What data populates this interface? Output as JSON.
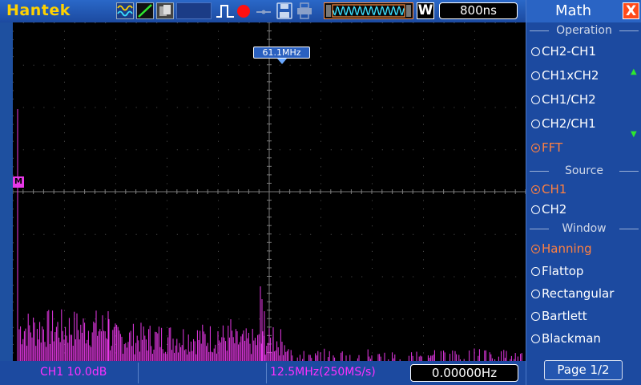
{
  "app": {
    "brand": "Hantek"
  },
  "toolbar": {
    "timebase_mark": "W",
    "timebase": "800ns"
  },
  "screen": {
    "freq_marker": "61.1MHz",
    "math_marker": "M"
  },
  "status": {
    "ch1_scale": "CH1 10.0dB",
    "sample_rate": "12.5MHz(250MS/s)",
    "freq_readout": "0.00000Hz"
  },
  "menu": {
    "title": "Math",
    "close": "X",
    "operation": {
      "label": "Operation",
      "options": [
        "CH2-CH1",
        "CH1xCH2",
        "CH1/CH2",
        "CH2/CH1",
        "FFT"
      ],
      "selected": "FFT"
    },
    "source": {
      "label": "Source",
      "options": [
        "CH1",
        "CH2"
      ],
      "selected": "CH1"
    },
    "window": {
      "label": "Window",
      "options": [
        "Hanning",
        "Flattop",
        "Rectangular",
        "Bartlett",
        "Blackman"
      ],
      "selected": "Hanning"
    },
    "page": "Page 1/2"
  },
  "colors": {
    "trace": "#e838e8",
    "selected": "#ff8040",
    "brand": "#ffd200",
    "panel": "#1c4aa0"
  }
}
